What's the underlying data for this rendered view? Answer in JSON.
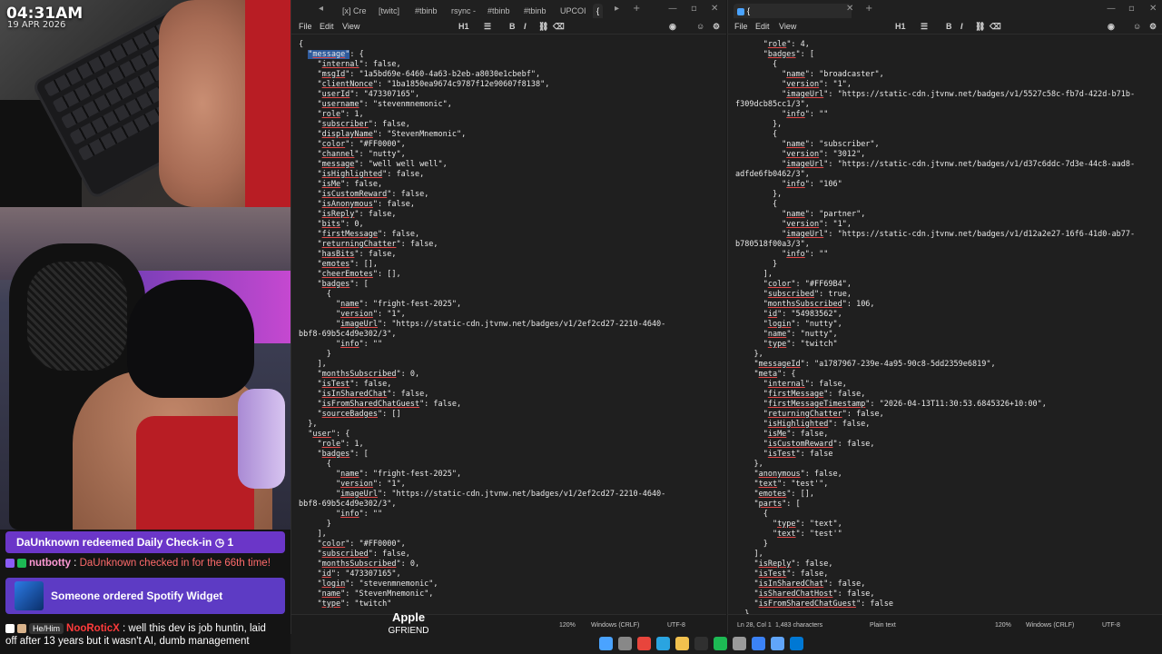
{
  "clock": {
    "time": "04:31AM",
    "date": "19 APR 2026"
  },
  "chat": {
    "redeem_text": "DaUnknown redeemed Daily Check-in ◷ 1",
    "line1_user": "nutbotty",
    "line1_msg": "DaUnknown checked in for the 66th time!",
    "order_text": "Someone ordered Spotify Widget",
    "line2_pronoun": "He/Him",
    "line2_user": "NooRoticX",
    "line2_msg": "well this dev is job huntin, laid",
    "line2_msg2": "off after 13 years but it wasn't AI, dumb management"
  },
  "now_playing": {
    "title": "Apple",
    "artist": "GFRIEND"
  },
  "editor_left": {
    "tabs": [
      "[x] Cre",
      "[twitc]",
      "#tbinb",
      "rsync -",
      "#tbinb",
      "#tbinb",
      "UPCOI",
      "{"
    ],
    "menu": [
      "File",
      "Edit",
      "View"
    ],
    "heading": "H1",
    "lines": [
      "{",
      "  \"message\": {",
      "    \"internal\": false,",
      "    \"msgId\": \"1a5bd69e-6460-4a63-b2eb-a8030e1cbebf\",",
      "    \"clientNonce\": \"1ba1850ea9674c9787f12e90607f8138\",",
      "    \"userId\": \"473307165\",",
      "    \"username\": \"stevenmnemonic\",",
      "    \"role\": 1,",
      "    \"subscriber\": false,",
      "    \"displayName\": \"StevenMnemonic\",",
      "    \"color\": \"#FF0000\",",
      "    \"channel\": \"nutty\",",
      "    \"message\": \"well well well\",",
      "    \"isHighlighted\": false,",
      "    \"isMe\": false,",
      "    \"isCustomReward\": false,",
      "    \"isAnonymous\": false,",
      "    \"isReply\": false,",
      "    \"bits\": 0,",
      "    \"firstMessage\": false,",
      "    \"returningChatter\": false,",
      "    \"hasBits\": false,",
      "    \"emotes\": [],",
      "    \"cheerEmotes\": [],",
      "    \"badges\": [",
      "      {",
      "        \"name\": \"fright-fest-2025\",",
      "        \"version\": \"1\",",
      "        \"imageUrl\": \"https://static-cdn.jtvnw.net/badges/v1/2ef2cd27-2210-4640-",
      "bbf8-69b5c4d9e302/3\",",
      "        \"info\": \"\"",
      "      }",
      "    ],",
      "    \"monthsSubscribed\": 0,",
      "    \"isTest\": false,",
      "    \"isInSharedChat\": false,",
      "    \"isFromSharedChatGuest\": false,",
      "    \"sourceBadges\": []",
      "  },",
      "  \"user\": {",
      "    \"role\": 1,",
      "    \"badges\": [",
      "      {",
      "        \"name\": \"fright-fest-2025\",",
      "        \"version\": \"1\",",
      "        \"imageUrl\": \"https://static-cdn.jtvnw.net/badges/v1/2ef2cd27-2210-4640-",
      "bbf8-69b5c4d9e302/3\",",
      "        \"info\": \"\"",
      "      }",
      "    ],",
      "    \"color\": \"#FF0000\",",
      "    \"subscribed\": false,",
      "    \"monthsSubscribed\": 0,",
      "    \"id\": \"473307165\",",
      "    \"login\": \"stevenmnemonic\",",
      "    \"name\": \"StevenMnemonic\",",
      "    \"type\": \"twitch\""
    ],
    "status": {
      "zoom": "120%",
      "eol": "Windows (CRLF)",
      "encoding": "UTF-8"
    }
  },
  "editor_right": {
    "tab": "{",
    "menu": [
      "File",
      "Edit",
      "View"
    ],
    "heading": "H1",
    "lines": [
      "      \"role\": 4,",
      "      \"badges\": [",
      "        {",
      "          \"name\": \"broadcaster\",",
      "          \"version\": \"1\",",
      "          \"imageUrl\": \"https://static-cdn.jtvnw.net/badges/v1/5527c58c-fb7d-422d-b71b-",
      "f309dcb85cc1/3\",",
      "          \"info\": \"\"",
      "        },",
      "        {",
      "          \"name\": \"subscriber\",",
      "          \"version\": \"3012\",",
      "          \"imageUrl\": \"https://static-cdn.jtvnw.net/badges/v1/d37c6ddc-7d3e-44c8-aad8-",
      "adfde6fb0462/3\",",
      "          \"info\": \"106\"",
      "        },",
      "        {",
      "          \"name\": \"partner\",",
      "          \"version\": \"1\",",
      "          \"imageUrl\": \"https://static-cdn.jtvnw.net/badges/v1/d12a2e27-16f6-41d0-ab77-",
      "b780518f00a3/3\",",
      "          \"info\": \"\"",
      "        }",
      "      ],",
      "      \"color\": \"#FF69B4\",",
      "      \"subscribed\": true,",
      "      \"monthsSubscribed\": 106,",
      "      \"id\": \"54983562\",",
      "      \"login\": \"nutty\",",
      "      \"name\": \"nutty\",",
      "      \"type\": \"twitch\"",
      "    },",
      "    \"messageId\": \"a1787967-239e-4a95-90c8-5dd2359e6819\",",
      "    \"meta\": {",
      "      \"internal\": false,",
      "      \"firstMessage\": false,",
      "      \"firstMessageTimestamp\": \"2026-04-13T11:30:53.6845326+10:00\",",
      "      \"returningChatter\": false,",
      "      \"isHighlighted\": false,",
      "      \"isMe\": false,",
      "      \"isCustomReward\": false,",
      "      \"isTest\": false",
      "    },",
      "    \"anonymous\": false,",
      "    \"text\": \"test'\",",
      "    \"emotes\": [],",
      "    \"parts\": [",
      "      {",
      "        \"type\": \"text\",",
      "        \"text\": \"test'\"",
      "      }",
      "    ],",
      "    \"isReply\": false,",
      "    \"isTest\": false,",
      "    \"isInSharedChat\": false,",
      "    \"isSharedChatHost\": false,",
      "    \"isFromSharedChatGuest\": false",
      "  }"
    ],
    "status": {
      "position": "Ln 28, Col 1",
      "chars": "1,483 characters",
      "format": "Plain text",
      "zoom": "120%",
      "eol": "Windows (CRLF)",
      "encoding": "UTF-8"
    }
  },
  "taskbar": {
    "icons": [
      "windows-icon",
      "search-icon",
      "chrome-icon",
      "edge-icon",
      "folder-icon",
      "terminal-icon",
      "spotify-icon",
      "app-icon",
      "files-icon",
      "notepad-icon",
      "vscode-icon"
    ],
    "colors": [
      "#4aa3ff",
      "#888888",
      "#e8453c",
      "#2aa4e0",
      "#f2c14e",
      "#303030",
      "#1db954",
      "#9a9a9a",
      "#3b82f6",
      "#60a5fa",
      "#0078d4"
    ]
  },
  "colors": {
    "redeem": "#6b36c8",
    "order": "#5d3bc4",
    "jersey": "#b81d24",
    "selection": "#2e5a9c"
  }
}
